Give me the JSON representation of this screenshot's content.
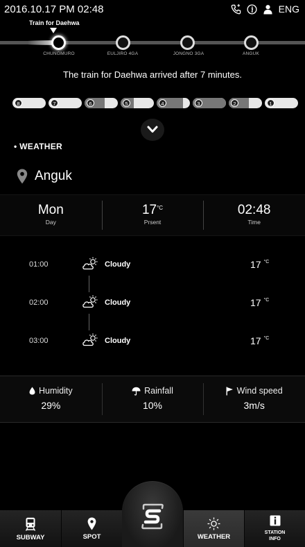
{
  "status_bar": {
    "datetime": "2016.10.17    PM 02:48",
    "language": "ENG"
  },
  "route": {
    "train_label": "Train for Daehwa",
    "stations": [
      "CHUNGMURO",
      "EULJIRO 4GA",
      "JONGNO 3GA",
      "ANGUK"
    ]
  },
  "arrival_message": "The train for Daehwa arrived after 7 minutes.",
  "cars": [
    {
      "num": "8",
      "occupancy": 0
    },
    {
      "num": "7",
      "occupancy": 0
    },
    {
      "num": "6",
      "occupancy": 0.6
    },
    {
      "num": "5",
      "occupancy": 0.4
    },
    {
      "num": "4",
      "occupancy": 0.8
    },
    {
      "num": "3",
      "occupancy": 1.0
    },
    {
      "num": "2",
      "occupancy": 0.6
    },
    {
      "num": "1",
      "occupancy": 0
    }
  ],
  "weather": {
    "section_title": "WEATHER",
    "location": "Anguk",
    "current": {
      "day": "Mon",
      "day_label": "Day",
      "temp": "17",
      "temp_unit": "°C",
      "temp_label": "Prsent",
      "time": "02:48",
      "time_label": "Time"
    },
    "forecast": [
      {
        "time": "01:00",
        "condition": "Cloudy",
        "temp": "17",
        "unit": "°C"
      },
      {
        "time": "02:00",
        "condition": "Cloudy",
        "temp": "17",
        "unit": "°C"
      },
      {
        "time": "03:00",
        "condition": "Cloudy",
        "temp": "17",
        "unit": "°C"
      }
    ],
    "stats": {
      "humidity_label": "Humidity",
      "humidity_value": "29%",
      "rainfall_label": "Rainfall",
      "rainfall_value": "10%",
      "wind_label": "Wind speed",
      "wind_value": "3m/s"
    }
  },
  "nav": {
    "subway": "SUBWAY",
    "spot": "SPOT",
    "weather": "WEATHER",
    "station_info_1": "STATION",
    "station_info_2": "INFO"
  },
  "icons": {
    "phone": "phone-icon",
    "info": "info-icon",
    "user": "user-icon",
    "location": "location-pin-icon",
    "weather_condition": "partly-cloudy-icon",
    "humidity": "water-drop-icon",
    "rainfall": "umbrella-icon",
    "wind": "flag-icon",
    "subway": "train-icon",
    "spot": "pin-icon",
    "weather_tab": "sun-icon",
    "station_info": "info-box-icon",
    "home": "logo-s-icon"
  }
}
